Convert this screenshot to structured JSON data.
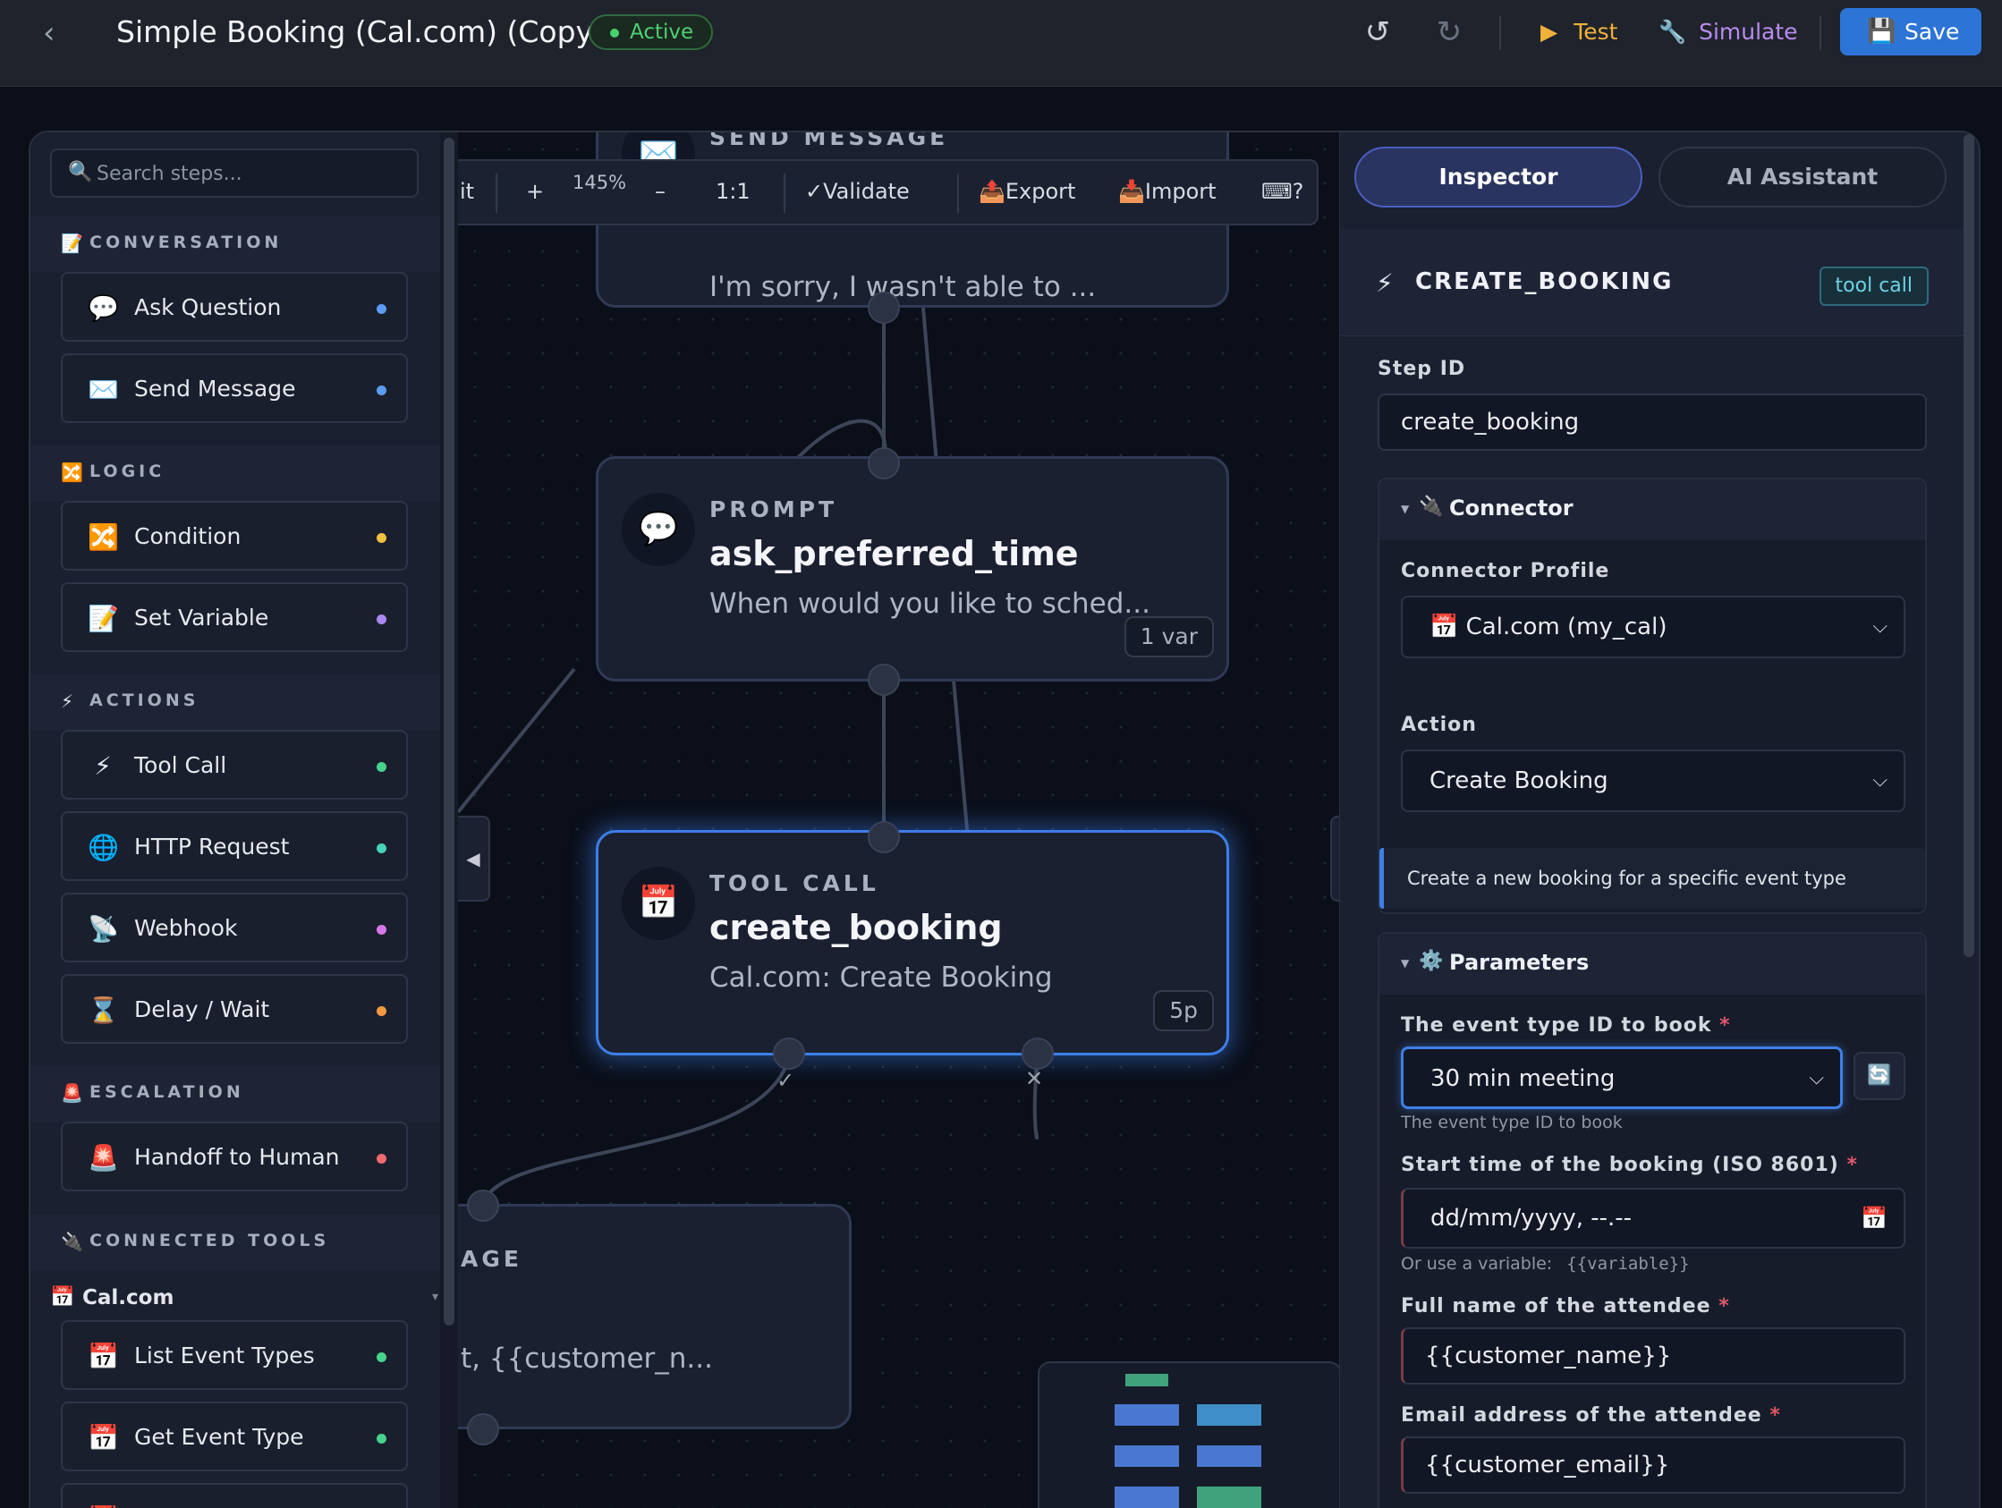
{
  "header": {
    "back_icon": "chevron-left-icon",
    "title": "Simple Booking (Cal.com) (Copy)",
    "status": "Active",
    "undo_icon": "undo-icon",
    "redo_icon": "redo-icon",
    "test_label": "Test",
    "simulate_label": "Simulate",
    "save_label": "Save",
    "accent": "#2c74d6"
  },
  "sidebar": {
    "search_placeholder": "Search steps...",
    "sections": [
      {
        "label": "CONVERSATION",
        "icon": "memo-icon",
        "items": [
          {
            "label": "Ask Question",
            "icon": "speech-bubble-icon",
            "dot": "#5b9cf0"
          },
          {
            "label": "Send Message",
            "icon": "envelope-icon",
            "dot": "#5b9cf0"
          }
        ]
      },
      {
        "label": "LOGIC",
        "icon": "shuffle-icon",
        "items": [
          {
            "label": "Condition",
            "icon": "shuffle-icon",
            "dot": "#f0c040"
          },
          {
            "label": "Set Variable",
            "icon": "memo-icon",
            "dot": "#a888f0"
          }
        ]
      },
      {
        "label": "ACTIONS",
        "icon": "lightning-icon",
        "items": [
          {
            "label": "Tool Call",
            "icon": "lightning-icon",
            "dot": "#46d28a"
          },
          {
            "label": "HTTP Request",
            "icon": "globe-icon",
            "dot": "#46d2b8"
          },
          {
            "label": "Webhook",
            "icon": "satellite-icon",
            "dot": "#d878e8"
          },
          {
            "label": "Delay / Wait",
            "icon": "hourglass-icon",
            "dot": "#f09a40"
          }
        ]
      },
      {
        "label": "ESCALATION",
        "icon": "siren-icon",
        "items": [
          {
            "label": "Handoff to Human",
            "icon": "siren-icon",
            "dot": "#f06a70"
          }
        ]
      },
      {
        "label": "CONNECTED TOOLS",
        "icon": "plug-icon",
        "items": []
      }
    ],
    "tool_group": "Cal.com",
    "tool_items": [
      {
        "label": "List Event Types",
        "icon": "calendar-icon",
        "dot": "#46d28a"
      },
      {
        "label": "Get Event Type",
        "icon": "calendar-icon",
        "dot": "#46d28a"
      }
    ]
  },
  "canvas": {
    "toolbar": {
      "fit": "it",
      "zoom_in": "+",
      "zoom": "145%",
      "zoom_out": "–",
      "reset": "1:1",
      "validate": "✓Validate",
      "export": "Export",
      "import": "Import",
      "help": "⌨?"
    },
    "nodes": [
      {
        "type": "SEND MESSAGE",
        "desc": "I'm sorry, I wasn't able to ..."
      },
      {
        "type": "PROMPT",
        "name": "ask_preferred_time",
        "desc": "When would you like to sched...",
        "badge": "1 var"
      },
      {
        "type": "TOOL CALL",
        "name": "create_booking",
        "desc": "Cal.com: Create Booking",
        "badge": "5p"
      },
      {
        "type": "AGE",
        "desc": "t, {{customer_n..."
      }
    ],
    "success_mark": "✓",
    "fail_mark": "✕"
  },
  "inspector": {
    "tabs": [
      "Inspector",
      "AI Assistant"
    ],
    "step_title": "CREATE_BOOKING",
    "step_tag": "tool call",
    "step_id_label": "Step ID",
    "step_id_value": "create_booking",
    "connector": {
      "title": "Connector",
      "profile_label": "Connector Profile",
      "profile_value": "📅 Cal.com (my_cal)",
      "action_label": "Action",
      "action_value": "Create Booking",
      "description": "Create a new booking for a specific event type"
    },
    "parameters": {
      "title": "Parameters",
      "event_type_label": "The event type ID to book",
      "event_type_value": "30 min meeting",
      "event_type_hint": "The event type ID to book",
      "start_label": "Start time of the booking (ISO 8601)",
      "start_placeholder": "dd/mm/yyyy, --.--",
      "start_hint_prefix": "Or use a variable:",
      "start_hint_var": "{{variable}}",
      "name_label": "Full name of the attendee",
      "name_value": "{{customer_name}}",
      "email_label": "Email address of the attendee",
      "email_value": "{{customer_email}}",
      "required_mark": "*"
    }
  }
}
